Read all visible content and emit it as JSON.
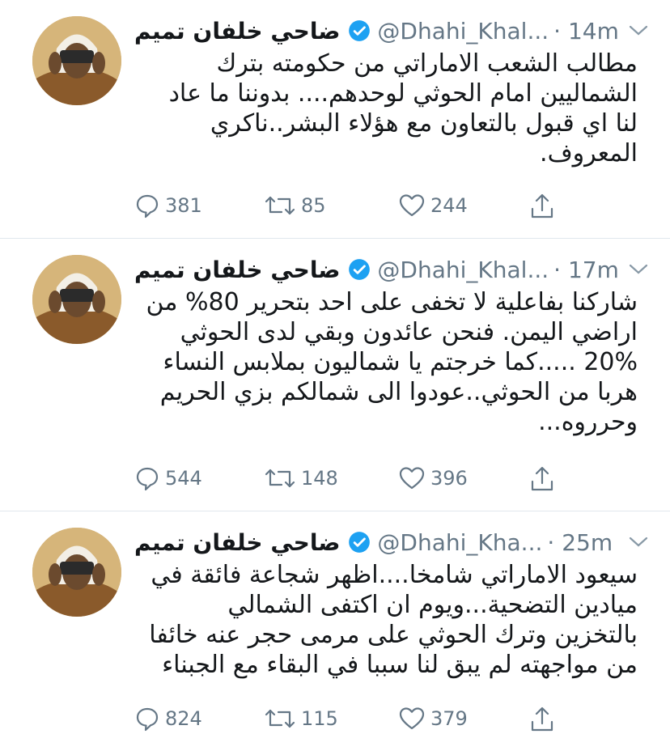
{
  "tweets": [
    {
      "name": "ضاحي خلفان تميم",
      "handle": "@Dhahi_Khal...",
      "time": "· 14m",
      "lines": [
        "مطالب الشعب الاماراتي من حكومته بترك",
        "الشماليين امام الحوثي لوحدهم.... بدوننا ما عاد",
        "لنا اي قبول بالتعاون مع هؤلاء البشر..ناكري",
        "المعروف."
      ],
      "replies": "381",
      "retweets": "85",
      "likes": "244"
    },
    {
      "name": "ضاحي خلفان تميم",
      "handle": "@Dhahi_Khal...",
      "time": "· 17m",
      "lines": [
        "شاركنا بفاعلية لا تخفى على احد بتحرير 80%  من",
        "اراضي اليمن. فنحن عائدون  وبقي لدى الحوثي",
        "20% .....كما خرجتم يا شماليون بملابس النساء",
        "هربا من الحوثي..عودوا الى شمالكم بزي الحريم",
        "وحرروه..."
      ],
      "replies": "544",
      "retweets": "148",
      "likes": "396"
    },
    {
      "name": "ضاحي خلفان تميم",
      "handle": "@Dhahi_Kha...",
      "time": "· 25m",
      "lines": [
        "سيعود الاماراتي شامخا....اظهر شجاعة فائقة في",
        "ميادين التضحية...ويوم ان اكتفى الشمالي",
        "بالتخزين وترك الحوثي على مرمى حجر عنه خائفا",
        "من مواجهته لم يبق لنا سببا في البقاء مع الجبناء"
      ],
      "replies": "824",
      "retweets": "115",
      "likes": "379"
    }
  ],
  "icons": {
    "reply": "reply-icon",
    "retweet": "retweet-icon",
    "like": "heart-icon",
    "share": "share-icon",
    "verified": "verified-badge-icon",
    "caret": "chevron-down-icon"
  },
  "colors": {
    "verified": "#1da1f2",
    "secondary_text": "#657786",
    "primary_text": "#14171a",
    "divider": "#e1e8ed"
  }
}
